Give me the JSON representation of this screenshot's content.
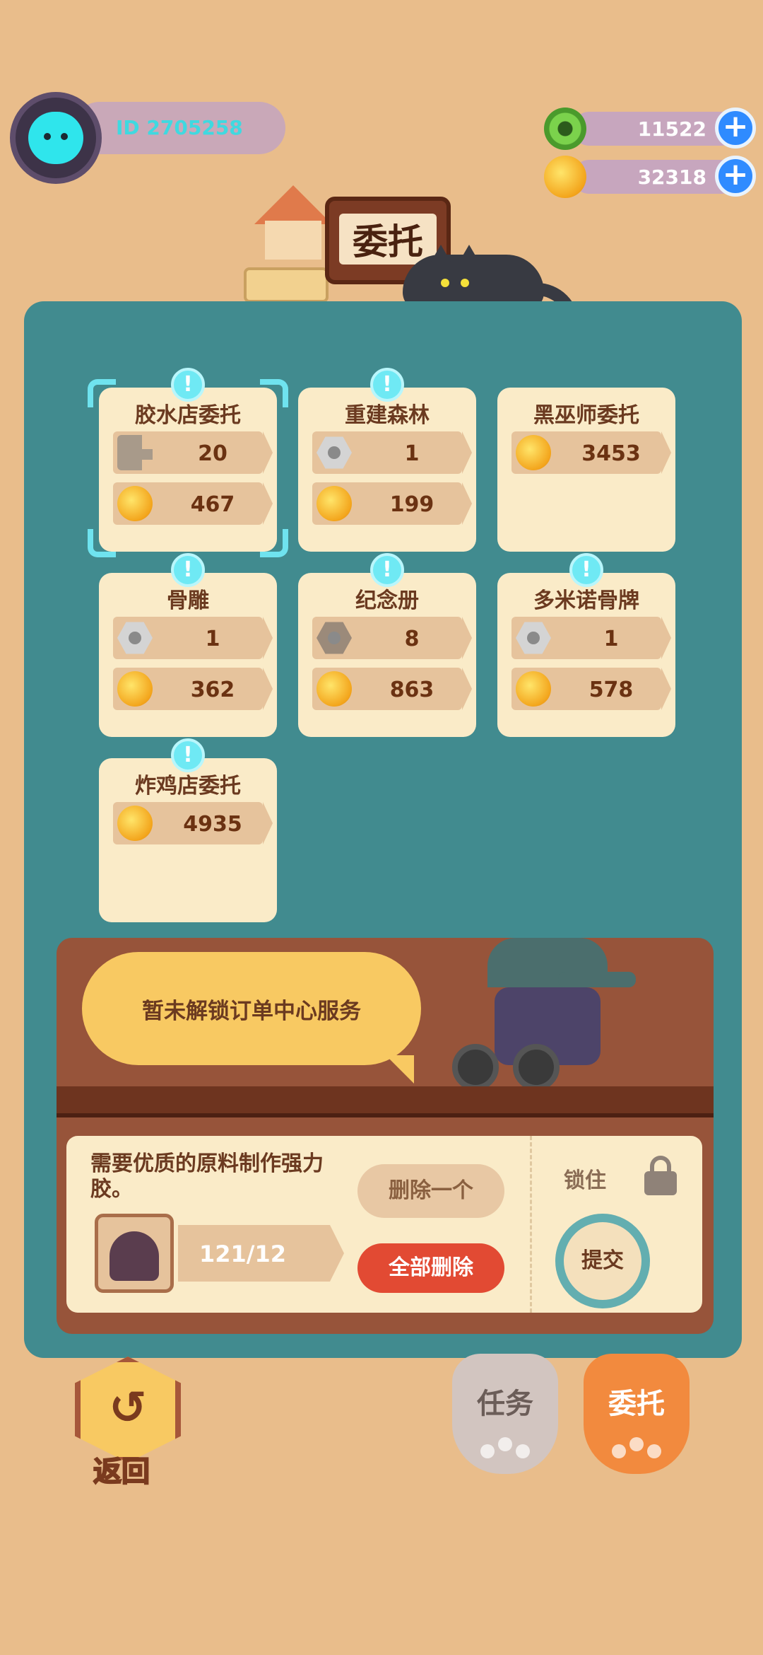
{
  "profile": {
    "id_text": "ID 2705258"
  },
  "currencies": [
    {
      "icon": "green-gem-coin",
      "value": "11522",
      "plus": "+"
    },
    {
      "icon": "gold-coin",
      "value": "32318",
      "plus": "+"
    }
  ],
  "title": "委托",
  "cards": [
    {
      "name": "胶水店委托",
      "rows": [
        {
          "icon": "bolt",
          "value": "20"
        },
        {
          "icon": "gold-coin",
          "value": "467"
        }
      ],
      "badge": "!"
    },
    {
      "name": "重建森林",
      "rows": [
        {
          "icon": "nut",
          "value": "1"
        },
        {
          "icon": "gold-coin",
          "value": "199"
        }
      ],
      "badge": "!"
    },
    {
      "name": "黑巫师委托",
      "rows": [
        {
          "icon": "gold-coin",
          "value": "3453"
        }
      ]
    },
    {
      "name": "骨雕",
      "rows": [
        {
          "icon": "nut",
          "value": "1"
        },
        {
          "icon": "gold-coin",
          "value": "362"
        }
      ],
      "badge": "!"
    },
    {
      "name": "纪念册",
      "rows": [
        {
          "icon": "dark-nut",
          "value": "8"
        },
        {
          "icon": "gold-coin",
          "value": "863"
        }
      ],
      "badge": "!"
    },
    {
      "name": "多米诺骨牌",
      "rows": [
        {
          "icon": "nut",
          "value": "1"
        },
        {
          "icon": "gold-coin",
          "value": "578"
        }
      ],
      "badge": "!"
    },
    {
      "name": "炸鸡店委托",
      "rows": [
        {
          "icon": "gold-coin",
          "value": "4935"
        }
      ],
      "badge": "!"
    }
  ],
  "order_center": {
    "message": "暂未解锁订单中心服务",
    "description": "需要优质的原料制作强力胶。",
    "progress": "121/12",
    "delete_one": "删除一个",
    "delete_all": "全部删除",
    "lock_label": "锁住",
    "submit": "提交"
  },
  "bottom": {
    "back_label": "返回",
    "tab_task": "任务",
    "tab_order": "委托"
  },
  "colors": {
    "background": "#e9bd8b",
    "panel": "#418b8f",
    "card": "#faebc8",
    "delete_all": "#e24a33",
    "active_tab": "#f28a3e"
  }
}
